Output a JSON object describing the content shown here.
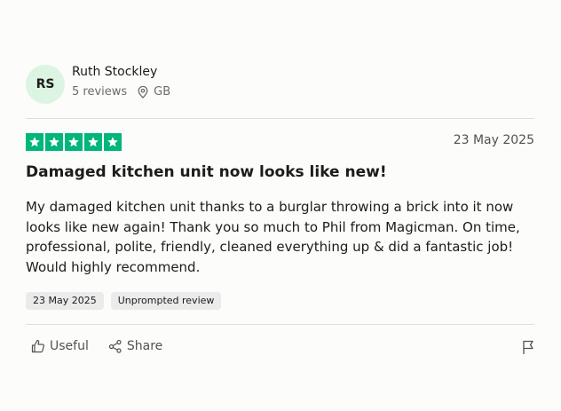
{
  "reviewer": {
    "initials": "RS",
    "name": "Ruth Stockley",
    "reviews_count": "5 reviews",
    "country": "GB"
  },
  "review": {
    "rating": 5,
    "date": "23 May 2025",
    "title": "Damaged kitchen unit now looks like new!",
    "body": "My damaged kitchen unit thanks to a burglar throwing a brick into it now looks like new again! Thank you so much to Phil from Magicman. On time, professional, polite, friendly, cleaned everything up & did a fantastic job! Would highly recommend.",
    "tags": [
      "23 May 2025",
      "Unprompted review"
    ]
  },
  "actions": {
    "useful_label": "Useful",
    "share_label": "Share"
  },
  "icons": [
    "location-pin-icon",
    "star-icon",
    "thumbs-up-icon",
    "share-icon",
    "flag-icon"
  ],
  "colors": {
    "star_green": "#00b67a",
    "avatar_bg": "#dcf5e2"
  }
}
